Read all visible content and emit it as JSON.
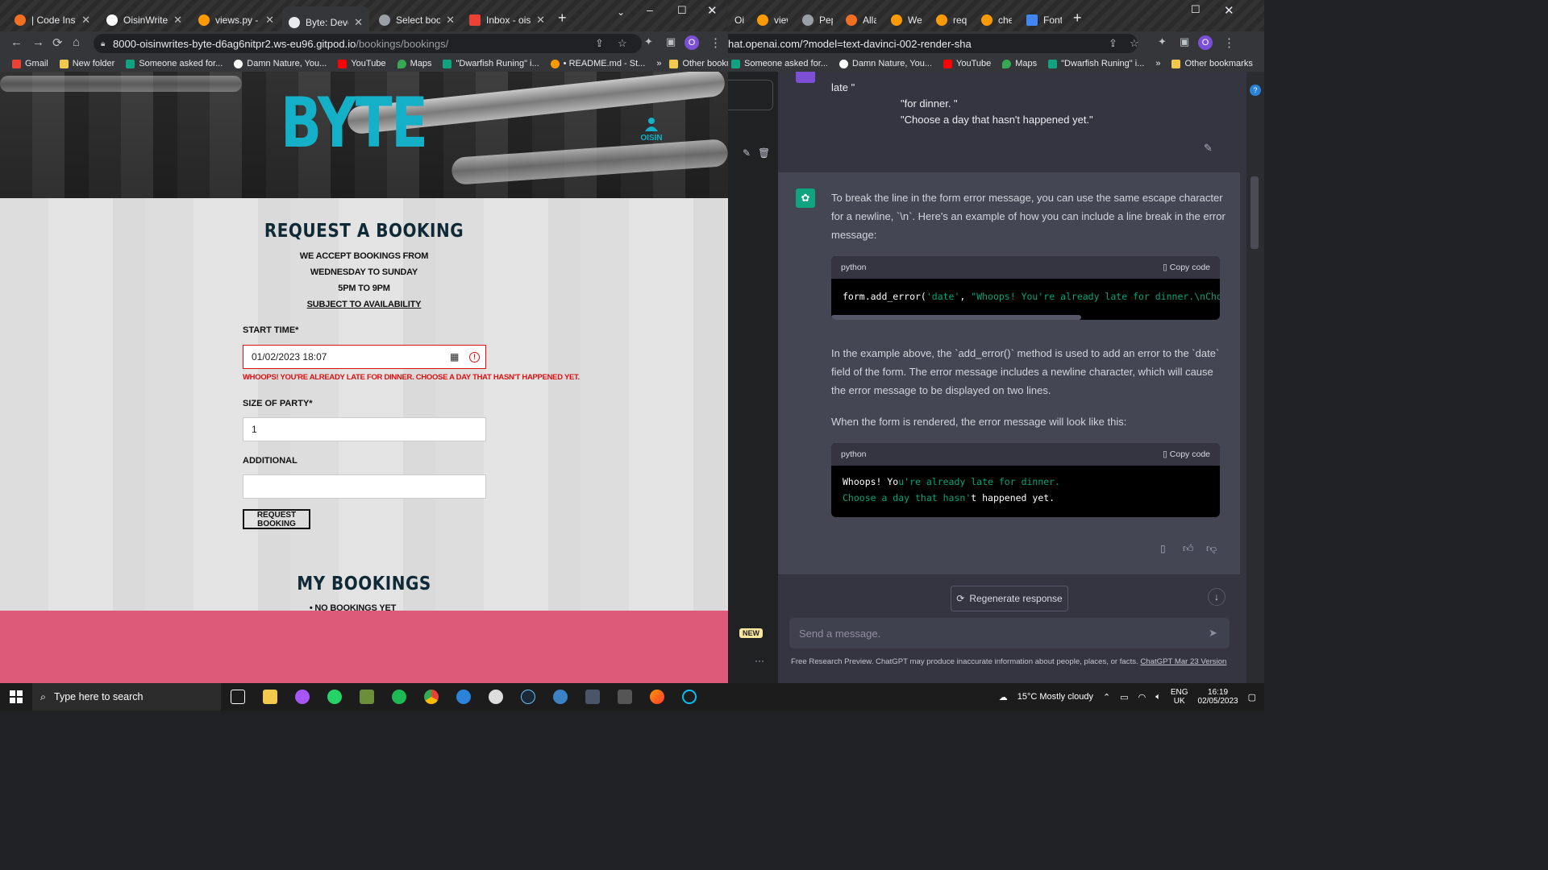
{
  "left_window": {
    "tabs": [
      {
        "title": "| Code Institu",
        "color": "#f36f21"
      },
      {
        "title": "OisinWrites/B",
        "color": "#ffffff"
      },
      {
        "title": "views.py - Byt",
        "color": "#ff9b00"
      },
      {
        "title": "Byte: Develop",
        "color": "#e8eaed",
        "active": true
      },
      {
        "title": "Select bookin",
        "color": "#9aa0a6"
      },
      {
        "title": "Inbox - oisin.",
        "color": "#ea4335"
      }
    ],
    "url_host": "8000-oisinwrites-byte-d6ag6nitpr2.ws-eu96.gitpod.io",
    "url_path": "/bookings/bookings/",
    "bookmarks": [
      {
        "label": "Gmail",
        "color": "#ea4335"
      },
      {
        "label": "New folder",
        "color": "#f2c94c"
      },
      {
        "label": "Someone asked for...",
        "color": "#10a37f"
      },
      {
        "label": "Damn Nature, You...",
        "color": "#ffffff"
      },
      {
        "label": "YouTube",
        "color": "#ff0000"
      },
      {
        "label": "Maps",
        "color": "#34a853"
      },
      {
        "label": "\"Dwarfish Runing\" i...",
        "color": "#10a37f"
      },
      {
        "label": "• README.md - St...",
        "color": "#ff9b00"
      }
    ],
    "other_bookmarks": "Other bookmarks"
  },
  "site": {
    "brand": "BYTE",
    "user": "OISIN",
    "title": "REQUEST A BOOKING",
    "info_lines": [
      "WE ACCEPT BOOKINGS FROM",
      "WEDNESDAY TO SUNDAY",
      "5PM TO 9PM"
    ],
    "availability": "SUBJECT TO AVAILABILITY",
    "start_time_label": "START TIME*",
    "start_time_value": "01/02/2023 18:07",
    "error": "WHOOPS! YOU'RE ALREADY LATE FOR DINNER. CHOOSE A DAY THAT HASN'T HAPPENED YET.",
    "party_label": "SIZE OF PARTY*",
    "party_value": "1",
    "additional_label": "ADDITIONAL",
    "additional_value": "",
    "request_button": "REQUEST BOOKING",
    "my_bookings": "MY BOOKINGS",
    "no_bookings": "NO BOOKINGS YET"
  },
  "right_window": {
    "tabs": [
      "Oisin",
      "views",
      "Pepp",
      "Allau",
      "Welc",
      "requ",
      "checl",
      "Font"
    ],
    "url": "hat.openai.com/?model=text-davinci-002-render-sha",
    "bookmarks": [
      "Someone asked for...",
      "Damn Nature, You...",
      "YouTube",
      "Maps",
      "\"Dwarfish Runing\" i..."
    ],
    "other_bookmarks": "Other bookmarks",
    "new_badge": "NEW"
  },
  "chat": {
    "user_lines": [
      "late \"",
      "\"for dinner. \"",
      "\"Choose a day that hasn't happened yet.\""
    ],
    "p1": "To break the line in the form error message, you can use the same escape character for a newline, `\\n`. Here's an example of how you can include a line break in the error message:",
    "code1_lang": "python",
    "copy_label": "Copy code",
    "code1_prefix": "form.add_error(",
    "code1_arg": "'date'",
    "code1_str": "\"Whoops! You're already late for dinner.\\nCho",
    "p2": "In the example above, the `add_error()` method is used to add an error to the `date` field of the form. The error message includes a newline character, which will cause the error message to be displayed on two lines.",
    "p3": "When the form is rendered, the error message will look like this:",
    "code2_lang": "python",
    "code2_line1a": "Whoops! Yo",
    "code2_line1b": "u're already late for dinner.",
    "code2_line2a": "Choose a day that hasn'",
    "code2_line2b": "t happened yet.",
    "regenerate": "Regenerate response",
    "input_placeholder": "Send a message.",
    "fine_print": "Free Research Preview. ChatGPT may produce inaccurate information about people, places, or facts.",
    "version_link": "ChatGPT Mar 23 Version"
  },
  "taskbar": {
    "search_placeholder": "Type here to search",
    "weather": "15°C  Mostly cloudy",
    "lang1": "ENG",
    "lang2": "UK",
    "time": "16:19",
    "date": "02/05/2023"
  }
}
